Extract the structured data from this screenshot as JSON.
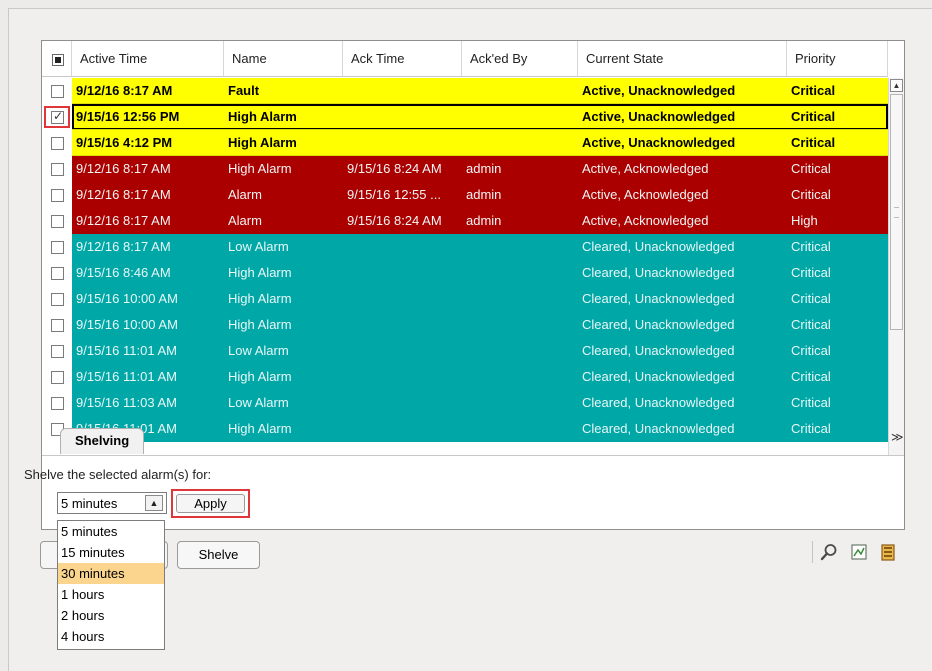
{
  "table": {
    "columns": [
      "Active Time",
      "Name",
      "Ack Time",
      "Ack'ed By",
      "Current State",
      "Priority"
    ],
    "rows": [
      {
        "state": "fault",
        "checked": false,
        "selected": false,
        "active_time": "9/12/16 8:17 AM",
        "name": "Fault",
        "ack_time": "",
        "acked_by": "",
        "current_state": "Active, Unacknowledged",
        "priority": "Critical"
      },
      {
        "state": "fault",
        "checked": true,
        "selected": true,
        "active_time": "9/15/16 12:56 PM",
        "name": "High Alarm",
        "ack_time": "",
        "acked_by": "",
        "current_state": "Active, Unacknowledged",
        "priority": "Critical"
      },
      {
        "state": "fault",
        "checked": false,
        "selected": false,
        "active_time": "9/15/16 4:12 PM",
        "name": "High Alarm",
        "ack_time": "",
        "acked_by": "",
        "current_state": "Active, Unacknowledged",
        "priority": "Critical"
      },
      {
        "state": "ack",
        "checked": false,
        "selected": false,
        "active_time": "9/12/16 8:17 AM",
        "name": "High Alarm",
        "ack_time": "9/15/16 8:24 AM",
        "acked_by": "admin",
        "current_state": "Active, Acknowledged",
        "priority": "Critical"
      },
      {
        "state": "ack",
        "checked": false,
        "selected": false,
        "active_time": "9/12/16 8:17 AM",
        "name": "Alarm",
        "ack_time": "9/15/16 12:55 ...",
        "acked_by": "admin",
        "current_state": "Active, Acknowledged",
        "priority": "Critical"
      },
      {
        "state": "ack",
        "checked": false,
        "selected": false,
        "active_time": "9/12/16 8:17 AM",
        "name": "Alarm",
        "ack_time": "9/15/16 8:24 AM",
        "acked_by": "admin",
        "current_state": "Active, Acknowledged",
        "priority": "High"
      },
      {
        "state": "cleared",
        "checked": false,
        "selected": false,
        "active_time": "9/12/16 8:17 AM",
        "name": "Low Alarm",
        "ack_time": "",
        "acked_by": "",
        "current_state": "Cleared, Unacknowledged",
        "priority": "Critical"
      },
      {
        "state": "cleared",
        "checked": false,
        "selected": false,
        "active_time": "9/15/16 8:46 AM",
        "name": "High Alarm",
        "ack_time": "",
        "acked_by": "",
        "current_state": "Cleared, Unacknowledged",
        "priority": "Critical"
      },
      {
        "state": "cleared",
        "checked": false,
        "selected": false,
        "active_time": "9/15/16 10:00 AM",
        "name": "High Alarm",
        "ack_time": "",
        "acked_by": "",
        "current_state": "Cleared, Unacknowledged",
        "priority": "Critical"
      },
      {
        "state": "cleared",
        "checked": false,
        "selected": false,
        "active_time": "9/15/16 10:00 AM",
        "name": "High Alarm",
        "ack_time": "",
        "acked_by": "",
        "current_state": "Cleared, Unacknowledged",
        "priority": "Critical"
      },
      {
        "state": "cleared",
        "checked": false,
        "selected": false,
        "active_time": "9/15/16 11:01 AM",
        "name": "Low Alarm",
        "ack_time": "",
        "acked_by": "",
        "current_state": "Cleared, Unacknowledged",
        "priority": "Critical"
      },
      {
        "state": "cleared",
        "checked": false,
        "selected": false,
        "active_time": "9/15/16 11:01 AM",
        "name": "High Alarm",
        "ack_time": "",
        "acked_by": "",
        "current_state": "Cleared, Unacknowledged",
        "priority": "Critical"
      },
      {
        "state": "cleared",
        "checked": false,
        "selected": false,
        "active_time": "9/15/16 11:03 AM",
        "name": "Low Alarm",
        "ack_time": "",
        "acked_by": "",
        "current_state": "Cleared, Unacknowledged",
        "priority": "Critical"
      },
      {
        "state": "cleared",
        "checked": false,
        "selected": false,
        "active_time": "9/15/16 11:01 AM",
        "name": "High Alarm",
        "ack_time": "",
        "acked_by": "",
        "current_state": "Cleared, Unacknowledged",
        "priority": "Critical"
      }
    ]
  },
  "shelving": {
    "tab_label": "Shelving",
    "prompt": "Shelve the selected alarm(s) for:",
    "selected": "5 minutes",
    "apply_label": "Apply",
    "options": [
      "5 minutes",
      "15 minutes",
      "30 minutes",
      "1 hours",
      "2 hours",
      "4 hours"
    ],
    "highlighted_option": "30 minutes"
  },
  "toolbar": {
    "shelve_label": "Shelve",
    "icons": [
      "magnifier-icon",
      "chart-icon",
      "export-icon"
    ]
  },
  "colors": {
    "fault": "#ffff00",
    "acknowledged": "#aa0000",
    "cleared": "#00a7a7",
    "highlight_box": "#e0363a",
    "option_highlight": "#fbd58e"
  }
}
